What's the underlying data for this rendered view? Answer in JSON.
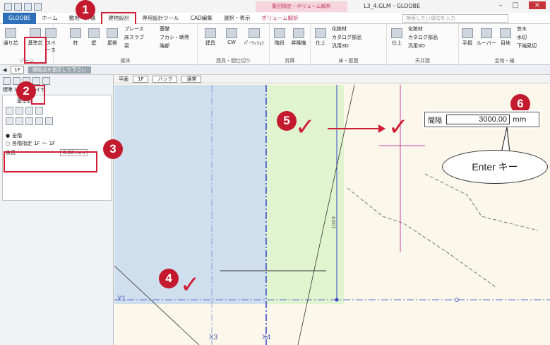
{
  "window": {
    "title": "L3_4.GLM - GLOOBE",
    "context_tab": "集団規定・ボリューム解析"
  },
  "tabs": [
    {
      "label": "GLOOBE"
    },
    {
      "label": "ホーム"
    },
    {
      "label": "敷地・外構"
    },
    {
      "label": "建物設計"
    },
    {
      "label": "専用設計ツール"
    },
    {
      "label": "CAD編集"
    },
    {
      "label": "選択・表示"
    },
    {
      "label": "ボリューム解析"
    }
  ],
  "search": {
    "placeholder": "検索したい語句を入力"
  },
  "ribbon": {
    "zone": {
      "label": "ゾーン",
      "btn1": "通り芯",
      "btn2": "基準芯",
      "btn3": "スペース"
    },
    "body": {
      "label": "躯体",
      "col": "柱",
      "wall": "壁",
      "roof": "屋根",
      "brace": "ブレース",
      "floor": "床スラブ",
      "beam": "梁",
      "found": "基礎",
      "fire": "フカシ・断熱",
      "end": "端部"
    },
    "fittings": {
      "label": "建具・間仕切り",
      "fit": "建具",
      "cw": "CW",
      "part": "ﾊﾟｰﾃｨｼｮﾝ"
    },
    "stair": {
      "label": "昇降",
      "st": "階段",
      "ele": "昇降機"
    },
    "floorwall": {
      "label": "床・壁面",
      "fin": "仕上",
      "a": "化粧材",
      "b": "カタログ部品",
      "c": "汎用3D"
    },
    "ceiling": {
      "label": "天井面",
      "fin": "仕上",
      "a": "化粧材",
      "b": "カタログ部品",
      "c": "汎用3D"
    },
    "hardware": {
      "label": "金物・樋",
      "h1": "手摺",
      "h2": "ルーバー",
      "h3": "目地",
      "h4": "笠木",
      "h5": "水切",
      "h6": "下端見切"
    }
  },
  "toolbar": {
    "floor": "1F",
    "scale": "標準 1/100",
    "layer": "レイヤ",
    "status": "開始点を指示して下さい"
  },
  "viewbar": {
    "view": "平面",
    "floor": "1F",
    "back": "バック",
    "mode": "通常"
  },
  "panel": {
    "title": "基準芯",
    "all": "全階",
    "each": "各階指定",
    "from": "1F",
    "tilde": "〜",
    "to": "1F",
    "margin_label": "余長",
    "margin_value": "0.00",
    "margin_unit": "mm"
  },
  "input": {
    "label": "間隔",
    "value": "3000.00",
    "unit": "mm"
  },
  "callout": {
    "text": "Enter キー"
  },
  "markers": [
    "1",
    "2",
    "3",
    "4",
    "5",
    "6"
  ],
  "grid": {
    "y1": "Y1",
    "x3": "X3",
    "x4": "X4",
    "dim": "1000"
  },
  "colors": {
    "accent": "#d11d36",
    "marker": "#c41a2e",
    "ctx": "#c0355b"
  }
}
